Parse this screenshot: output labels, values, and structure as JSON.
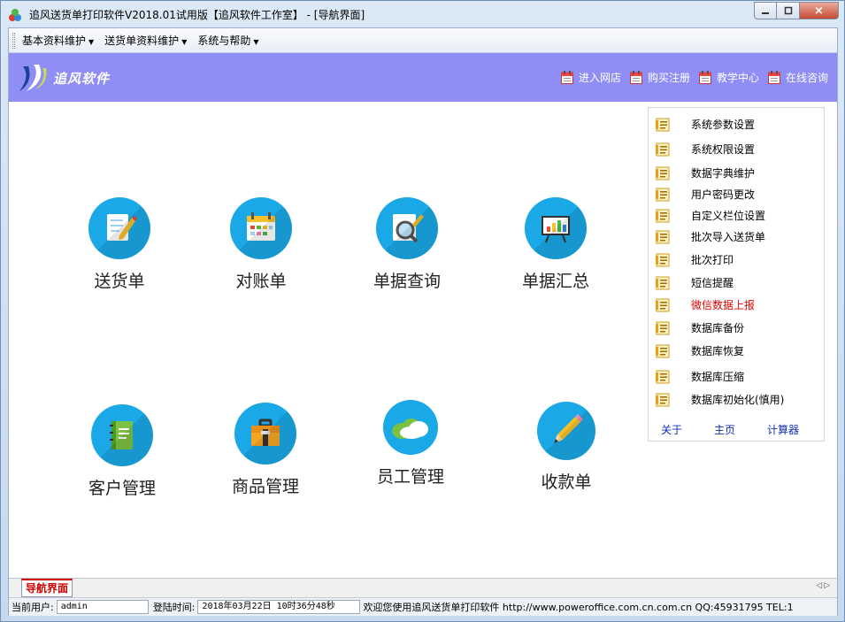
{
  "window": {
    "title": "追风送货单打印软件V2018.01试用版【追风软件工作室】 - [导航界面]",
    "close_label": "×"
  },
  "menubar": {
    "items": [
      {
        "label": "基本资料维护"
      },
      {
        "label": "送货单资料维护"
      },
      {
        "label": "系统与帮助"
      }
    ]
  },
  "banner": {
    "brand": "追风软件",
    "links": [
      {
        "label": "进入网店"
      },
      {
        "label": "购买注册"
      },
      {
        "label": "教学中心"
      },
      {
        "label": "在线咨询"
      }
    ]
  },
  "tiles": [
    {
      "label": "送货单",
      "icon": "notepad-pencil-icon"
    },
    {
      "label": "对账单",
      "icon": "calendar-icon"
    },
    {
      "label": "单据查询",
      "icon": "magnifier-icon"
    },
    {
      "label": "单据汇总",
      "icon": "presentation-chart-icon"
    },
    {
      "label": "客户管理",
      "icon": "address-book-icon"
    },
    {
      "label": "商品管理",
      "icon": "toolbox-icon"
    },
    {
      "label": "员工管理",
      "icon": "cloud-icon"
    },
    {
      "label": "收款单",
      "icon": "pencil-icon"
    }
  ],
  "panel": {
    "items": [
      {
        "label": "系统参数设置"
      },
      {
        "label": "系统权限设置"
      },
      {
        "label": "数据字典维护"
      },
      {
        "label": "用户密码更改"
      },
      {
        "label": "自定义栏位设置"
      },
      {
        "label": "批次导入送货单"
      },
      {
        "label": "批次打印"
      },
      {
        "label": "短信提醒"
      },
      {
        "label": "微信数据上报"
      },
      {
        "label": "数据库备份"
      },
      {
        "label": "数据库恢复"
      },
      {
        "label": "数据库压缩"
      },
      {
        "label": "数据库初始化(慎用)"
      }
    ],
    "links": [
      {
        "label": "关于"
      },
      {
        "label": "主页"
      },
      {
        "label": "计算器"
      }
    ]
  },
  "tabbar": {
    "active_tab": "导航界面"
  },
  "statusbar": {
    "user_label": "当前用户:",
    "user_value": "admin",
    "login_label": "登陆时间:",
    "login_value": "2018年03月22日 10时36分48秒",
    "welcome": "欢迎您使用追风送货单打印软件 http://www.poweroffice.com.cn.com.cn QQ:45931795 TEL:1"
  },
  "colors": {
    "banner_bg": "#8f8ef6",
    "tile_circle": "#1aa8e6",
    "highlight_red": "#e00000",
    "link_blue": "#1030b0"
  }
}
